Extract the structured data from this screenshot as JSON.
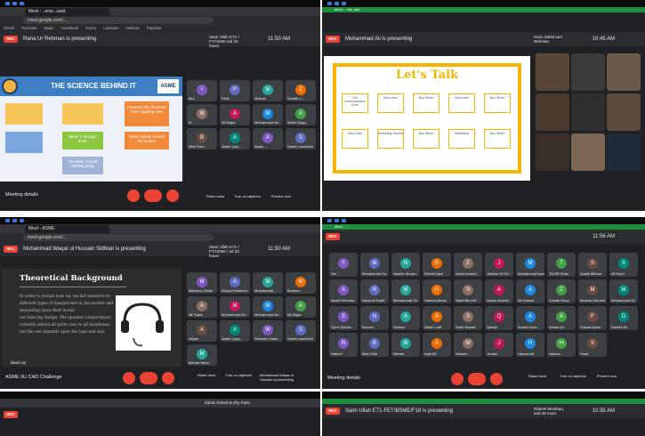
{
  "q1": {
    "tab_title": "Meet - ..enw...swkt",
    "url": "meet.google.com/...",
    "bookmarks": [
      "Gmail",
      "YouTube",
      "Maps",
      "Facebook",
      "Home",
      "LinkedIn",
      "Outlook",
      "Playlists"
    ],
    "presenting": "Rana Ur Rehman is presenting",
    "clock": "11:50 AM",
    "hand": "Sami Ullah E71 / FT/AEMs /ad 20 hours",
    "slide_title": "THE SCIENCE BEHIND IT",
    "acme_logo": "ASME",
    "flow": [
      "Prevents the structure from toppling over",
      "Gnoe hollow cannot be broken",
      "Wider / stronger Ever",
      "The Main Candle Holding Body"
    ],
    "participants": [
      "Ibni",
      "Pinki",
      "Mohsin",
      "Zohaib u...",
      "M",
      "Ali Sajaz",
      "Muhammad Ab...",
      "Abdul Qayy...",
      "Bilal Tahir...",
      "Abdul Qad...",
      "Abdul ...",
      "Saeed Jamshed"
    ],
    "meeting_details": "Meeting details",
    "side_buttons": [
      "Raise hand",
      "Turn on captions",
      "Hide participants",
      "Present now"
    ]
  },
  "q2": {
    "tab_title": "Meet - ..wa..wpt",
    "presenting": "Muhammad Ali is presenting",
    "clock": "10:45 AM",
    "hand": "Haris Zahid and Rehman",
    "slide_title": "Let's Talk",
    "labels": [
      "Tue communication Kind",
      "Bus Lines",
      "Bus Street",
      "Bus Lines",
      "Bus Street",
      "Bus Lines",
      "Marketing Service",
      "Bus Street",
      "Marketing",
      "Bus Street"
    ],
    "tile_badge": "Muhammad Ali"
  },
  "q3": {
    "tab_title": "Meet - ASME",
    "presenting": "Muhammad Waqar ul Hussain Sidhlan is presenting",
    "clock": "11:50 AM",
    "hand": "Sami Ullah E71 / FT/AEMs / ad 20 hours",
    "slide_title": "Theoretical Background",
    "slide_text": [
      "In order to design bass up, we did research on",
      "different types of headphones in the market and",
      "depending upon their model",
      "our boss my design. The speaker compartment",
      "contains almost all parts uses to all earphones",
      "but the one depends upon the type and size"
    ],
    "presenter_name": "Bass Up",
    "participants": [
      "Mahnoor Zahid",
      "Ahmad Nadeem",
      "Muhammad ...",
      "Mubeen",
      "Ali Sajaz",
      "Muhammad Ab...",
      "Muhammad Ab...",
      "Ali Sajaz",
      "Aliyan",
      "Abdul Qayy...",
      "Waseem Hass...",
      "Saeed Jamshed",
      "Mehak Hana"
    ],
    "meeting_details": "ASME IIU CAD Challenge",
    "side_buttons": [
      "Raise hand",
      "Turn on captions",
      "Muhammad Waqar ul Hussain is presenting",
      "Present now"
    ]
  },
  "q4": {
    "tab_title": "Meet - ...",
    "clock": "11:56 AM",
    "participants": [
      "Yar",
      "Muhammad Hu...",
      "Naseer Musta...",
      "Rehfat Qazi",
      "Zahid Ahmed",
      "Jahfaar Ali Sh...",
      "Muhammad Awa...",
      "TAHIR Khan",
      "Saalik Iftikhar",
      "Ali Sami",
      "Abdul Rehman",
      "Naveed Sharif",
      "Muhammad Sh...",
      "Hasnat Akram",
      "Saad Bin Arif",
      "Aasim Ahmad",
      "Ali Hamza",
      "Zohaib Khan",
      "Mubeen Ahmed",
      "Muhammad Ali",
      "Syed Shahid",
      "Noman",
      "Ammar",
      "Abdul Latif",
      "Shah Nawaz",
      "Qamar",
      "Anwar Khan",
      "Ahsan Ali",
      "Fawad Awan",
      "Danish Ali",
      "Nabeel",
      "Bilal Tahir",
      "Mehak",
      "Aqib Ali",
      "Waleed",
      "Junaid",
      "Hamza Ali",
      "Hamza",
      "Saad"
    ],
    "meeting_details": "Meeting details",
    "side_buttons": [
      "Raise hand",
      "Turn on captions",
      "Present now"
    ]
  },
  "q5": {
    "presenting": "Sami Ullah E71-FET/BSME/F18 is presenting",
    "clock": "10:35 AM",
    "hand": "Rabeel Mushtaq and 38 more"
  },
  "q6": {
    "hand": "Zahid Ahmed & Zhy Faris"
  }
}
